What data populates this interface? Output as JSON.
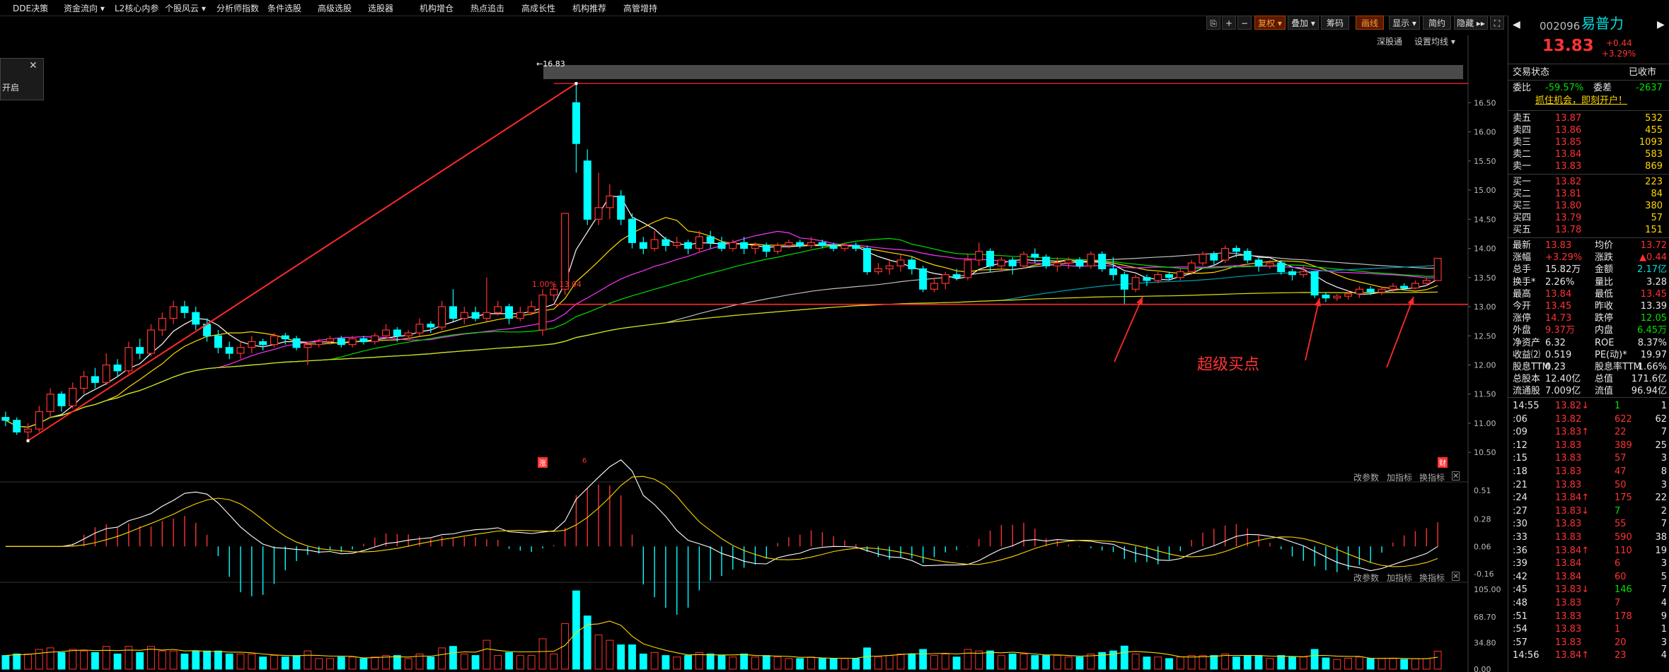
{
  "menu": [
    "DDE决策",
    "资金流向 ▾",
    "L2核心内参",
    "个股风云 ▾",
    "分析师指数",
    "条件选股",
    "高级选股",
    "选股器",
    "机构增仓",
    "热点追击",
    "高成长性",
    "机构推荐",
    "高管增持"
  ],
  "toolbar": {
    "icons": [
      "⎘",
      "+",
      "−"
    ],
    "buttons": [
      "复权 ▾",
      "叠加 ▾",
      "筹码",
      "画线",
      "显示 ▾",
      "简约",
      "隐藏 ▸▸"
    ],
    "active": [
      "复权 ▾",
      "画线"
    ],
    "fullscreen_icon": "⛶"
  },
  "chart_links": {
    "a": "深股通",
    "b": "设置均线 ▾"
  },
  "panel_tools": [
    "改参数",
    "加指标",
    "换指标"
  ],
  "left_popup_label": "开启",
  "annotations": {
    "high_label": "←16.83",
    "support_label": "1.00% 13.04",
    "buy_point": "超级买点",
    "badge_zhang": "涨",
    "badge_six": "6",
    "badge_cai": "财"
  },
  "colors": {
    "up": "#ff3232",
    "down": "#00ffff",
    "ma5": "#ffffff",
    "ma10": "#ffd700",
    "ma20": "#ff33ff",
    "ma30": "#00e000",
    "ma60": "#c0c0c0",
    "ma120": "#00a0b0",
    "ma250": "#e0e000"
  },
  "chart_data": {
    "type": "candlestick",
    "price_axis": [
      "16.50",
      "16.00",
      "15.50",
      "15.00",
      "14.50",
      "14.00",
      "13.50",
      "13.00",
      "12.50",
      "12.00",
      "11.50",
      "11.00",
      "10.50"
    ],
    "price_range": [
      10.26,
      16.88
    ],
    "hline": 13.04,
    "high": 16.83,
    "low": 10.7,
    "candles": [
      [
        11.1,
        11.05,
        11.2,
        10.95
      ],
      [
        11.05,
        10.85,
        11.1,
        10.8
      ],
      [
        10.85,
        10.9,
        11.0,
        10.7
      ],
      [
        10.9,
        11.2,
        11.3,
        10.85
      ],
      [
        11.2,
        11.5,
        11.6,
        11.1
      ],
      [
        11.5,
        11.3,
        11.55,
        11.2
      ],
      [
        11.3,
        11.6,
        11.7,
        11.25
      ],
      [
        11.6,
        11.8,
        11.9,
        11.5
      ],
      [
        11.8,
        11.7,
        11.95,
        11.6
      ],
      [
        11.7,
        12.0,
        12.2,
        11.65
      ],
      [
        12.0,
        11.9,
        12.1,
        11.8
      ],
      [
        11.9,
        12.3,
        12.4,
        11.85
      ],
      [
        12.3,
        12.2,
        12.45,
        12.1
      ],
      [
        12.2,
        12.6,
        12.7,
        12.15
      ],
      [
        12.6,
        12.8,
        12.9,
        12.5
      ],
      [
        12.8,
        13.0,
        13.1,
        12.7
      ],
      [
        13.0,
        12.9,
        13.1,
        12.8
      ],
      [
        12.9,
        12.7,
        13.0,
        12.6
      ],
      [
        12.7,
        12.5,
        12.8,
        12.4
      ],
      [
        12.5,
        12.3,
        12.6,
        12.2
      ],
      [
        12.3,
        12.2,
        12.4,
        12.1
      ],
      [
        12.2,
        12.3,
        12.4,
        12.1
      ],
      [
        12.3,
        12.4,
        12.5,
        12.2
      ],
      [
        12.4,
        12.35,
        12.45,
        12.25
      ],
      [
        12.35,
        12.5,
        12.55,
        12.3
      ],
      [
        12.5,
        12.45,
        12.55,
        12.35
      ],
      [
        12.45,
        12.3,
        12.5,
        12.25
      ],
      [
        12.3,
        12.35,
        12.4,
        12.0
      ],
      [
        12.35,
        12.4,
        12.45,
        12.3
      ],
      [
        12.4,
        12.45,
        12.5,
        12.35
      ],
      [
        12.45,
        12.35,
        12.5,
        12.3
      ],
      [
        12.35,
        12.45,
        12.5,
        12.3
      ],
      [
        12.45,
        12.4,
        12.5,
        12.35
      ],
      [
        12.4,
        12.5,
        12.55,
        12.35
      ],
      [
        12.5,
        12.6,
        12.7,
        12.45
      ],
      [
        12.6,
        12.5,
        12.65,
        12.4
      ],
      [
        12.5,
        12.55,
        12.6,
        12.45
      ],
      [
        12.55,
        12.7,
        12.8,
        12.5
      ],
      [
        12.7,
        12.65,
        12.75,
        12.55
      ],
      [
        12.65,
        13.0,
        13.1,
        12.6
      ],
      [
        13.0,
        12.8,
        13.3,
        12.75
      ],
      [
        12.8,
        12.9,
        13.0,
        12.7
      ],
      [
        12.9,
        12.8,
        13.0,
        12.75
      ],
      [
        12.8,
        12.9,
        13.5,
        12.75
      ],
      [
        12.9,
        13.0,
        13.1,
        12.85
      ],
      [
        13.0,
        12.8,
        13.05,
        12.7
      ],
      [
        12.8,
        12.9,
        13.0,
        12.75
      ],
      [
        12.9,
        13.0,
        13.1,
        12.85
      ],
      [
        12.6,
        13.2,
        13.3,
        12.5
      ],
      [
        13.2,
        13.3,
        13.4,
        13.1
      ],
      [
        13.3,
        14.6,
        14.6,
        13.2
      ],
      [
        16.5,
        15.8,
        16.83,
        15.3
      ],
      [
        15.5,
        14.5,
        15.7,
        14.4
      ],
      [
        14.5,
        14.7,
        15.3,
        14.4
      ],
      [
        14.7,
        14.9,
        15.1,
        14.5
      ],
      [
        14.9,
        14.5,
        15.0,
        14.4
      ],
      [
        14.5,
        14.1,
        14.6,
        14.0
      ],
      [
        14.1,
        14.0,
        14.2,
        13.9
      ],
      [
        14.0,
        14.15,
        14.3,
        13.95
      ],
      [
        14.15,
        14.05,
        14.2,
        13.95
      ],
      [
        14.05,
        14.1,
        14.2,
        14.0
      ],
      [
        14.1,
        14.0,
        14.15,
        13.9
      ],
      [
        14.0,
        14.2,
        14.3,
        13.95
      ],
      [
        14.2,
        14.1,
        14.3,
        14.0
      ],
      [
        14.1,
        14.0,
        14.2,
        13.95
      ],
      [
        14.0,
        14.1,
        14.15,
        13.95
      ],
      [
        14.1,
        14.0,
        14.2,
        13.9
      ],
      [
        14.0,
        14.05,
        14.1,
        13.9
      ],
      [
        14.05,
        13.95,
        14.1,
        13.85
      ],
      [
        13.95,
        14.05,
        14.1,
        13.9
      ],
      [
        14.05,
        14.1,
        14.15,
        14.0
      ],
      [
        14.1,
        14.05,
        14.15,
        14.0
      ],
      [
        14.05,
        14.1,
        14.2,
        14.0
      ],
      [
        14.1,
        14.05,
        14.15,
        14.0
      ],
      [
        14.05,
        14.0,
        14.1,
        13.95
      ],
      [
        14.0,
        14.05,
        14.1,
        13.95
      ],
      [
        14.05,
        14.0,
        14.1,
        13.95
      ],
      [
        14.0,
        13.6,
        14.05,
        13.55
      ],
      [
        13.6,
        13.65,
        13.75,
        13.55
      ],
      [
        13.65,
        13.7,
        13.8,
        13.55
      ],
      [
        13.7,
        13.8,
        13.9,
        13.6
      ],
      [
        13.8,
        13.65,
        13.85,
        13.55
      ],
      [
        13.65,
        13.3,
        13.7,
        13.25
      ],
      [
        13.3,
        13.4,
        13.5,
        13.25
      ],
      [
        13.4,
        13.55,
        13.6,
        13.3
      ],
      [
        13.55,
        13.5,
        13.65,
        13.45
      ],
      [
        13.5,
        13.8,
        13.9,
        13.45
      ],
      [
        13.8,
        13.95,
        14.1,
        13.7
      ],
      [
        13.95,
        13.7,
        14.0,
        13.6
      ],
      [
        13.7,
        13.8,
        13.85,
        13.6
      ],
      [
        13.8,
        13.7,
        13.85,
        13.55
      ],
      [
        13.7,
        13.9,
        13.95,
        13.65
      ],
      [
        13.9,
        13.85,
        14.0,
        13.75
      ],
      [
        13.85,
        13.7,
        13.9,
        13.65
      ],
      [
        13.7,
        13.75,
        13.85,
        13.6
      ],
      [
        13.75,
        13.8,
        13.85,
        13.65
      ],
      [
        13.8,
        13.7,
        13.85,
        13.65
      ],
      [
        13.7,
        13.9,
        13.95,
        13.65
      ],
      [
        13.9,
        13.65,
        13.95,
        13.6
      ],
      [
        13.65,
        13.55,
        13.85,
        13.45
      ],
      [
        13.55,
        13.3,
        13.6,
        13.04
      ],
      [
        13.3,
        13.5,
        13.55,
        13.25
      ],
      [
        13.5,
        13.45,
        13.55,
        13.35
      ],
      [
        13.45,
        13.55,
        13.6,
        13.4
      ],
      [
        13.55,
        13.5,
        13.6,
        13.45
      ],
      [
        13.5,
        13.6,
        13.65,
        13.45
      ],
      [
        13.6,
        13.75,
        13.8,
        13.55
      ],
      [
        13.75,
        13.9,
        13.95,
        13.7
      ],
      [
        13.9,
        13.8,
        13.95,
        13.7
      ],
      [
        13.8,
        14.0,
        14.05,
        13.75
      ],
      [
        14.0,
        13.95,
        14.05,
        13.85
      ],
      [
        13.95,
        13.8,
        14.0,
        13.75
      ],
      [
        13.8,
        13.7,
        13.85,
        13.6
      ],
      [
        13.7,
        13.75,
        13.8,
        13.65
      ],
      [
        13.75,
        13.6,
        13.8,
        13.55
      ],
      [
        13.6,
        13.55,
        13.65,
        13.45
      ],
      [
        13.55,
        13.6,
        13.7,
        13.5
      ],
      [
        13.6,
        13.2,
        13.6,
        13.15
      ],
      [
        13.2,
        13.15,
        13.25,
        13.08
      ],
      [
        13.15,
        13.18,
        13.22,
        13.1
      ],
      [
        13.18,
        13.22,
        13.28,
        13.12
      ],
      [
        13.22,
        13.3,
        13.35,
        13.15
      ],
      [
        13.3,
        13.25,
        13.35,
        13.2
      ],
      [
        13.25,
        13.3,
        13.35,
        13.2
      ],
      [
        13.3,
        13.35,
        13.4,
        13.25
      ],
      [
        13.35,
        13.32,
        13.4,
        13.28
      ],
      [
        13.32,
        13.4,
        13.45,
        13.3
      ],
      [
        13.4,
        13.45,
        13.5,
        13.35
      ],
      [
        13.45,
        13.83,
        13.84,
        13.45
      ]
    ],
    "macd_axis": [
      "0.51",
      "0.28",
      "0.06",
      "-0.16"
    ],
    "vol_axis": [
      "105.00",
      "68.70",
      "34.80",
      "0.00"
    ]
  },
  "quote": {
    "code": "002096",
    "name": "易普力",
    "price": "13.83",
    "change": "+0.44",
    "change_pct": "+3.29%",
    "status_label": "交易状态",
    "status_value": "已收市",
    "wb_label": "委比",
    "wb_value": "-59.57%",
    "wc_label": "委差",
    "wc_value": "-2637",
    "promo": "抓住机会，即刻开户！",
    "asks": [
      [
        "卖五",
        "13.87",
        "532"
      ],
      [
        "卖四",
        "13.86",
        "455"
      ],
      [
        "卖三",
        "13.85",
        "1093"
      ],
      [
        "卖二",
        "13.84",
        "583"
      ],
      [
        "卖一",
        "13.83",
        "869"
      ]
    ],
    "bids": [
      [
        "买一",
        "13.82",
        "223"
      ],
      [
        "买二",
        "13.81",
        "84"
      ],
      [
        "买三",
        "13.80",
        "380"
      ],
      [
        "买四",
        "13.79",
        "57"
      ],
      [
        "买五",
        "13.78",
        "151"
      ]
    ],
    "stats": [
      [
        "最新",
        "13.83",
        "均价",
        "13.72"
      ],
      [
        "涨幅",
        "+3.29%",
        "涨跌",
        "▲0.44"
      ],
      [
        "总手",
        "15.82万",
        "金额",
        "2.17亿"
      ],
      [
        "换手*",
        "2.26%",
        "量比",
        "3.28"
      ],
      [
        "最高",
        "13.84",
        "最低",
        "13.45"
      ],
      [
        "今开",
        "13.45",
        "昨收",
        "13.39"
      ],
      [
        "涨停",
        "14.73",
        "跌停",
        "12.05"
      ],
      [
        "外盘",
        "9.37万",
        "内盘",
        "6.45万"
      ],
      [
        "净资产",
        "6.32",
        "ROE",
        "8.37%"
      ],
      [
        "收益⑵",
        "0.519",
        "PE(动)*",
        "19.97"
      ],
      [
        "股息TTM",
        "0.23",
        "股息率TTM",
        "1.66%"
      ],
      [
        "总股本",
        "12.40亿",
        "总值",
        "171.6亿"
      ],
      [
        "流通股",
        "7.009亿",
        "流值",
        "96.94亿"
      ]
    ],
    "ticks": [
      [
        "14:55",
        "13.82",
        "↓",
        "1",
        "1"
      ],
      [
        ":06",
        "13.82",
        "",
        "622",
        "62"
      ],
      [
        ":09",
        "13.83",
        "↑",
        "22",
        "7"
      ],
      [
        ":12",
        "13.83",
        "",
        "389",
        "25"
      ],
      [
        ":15",
        "13.83",
        "",
        "57",
        "3"
      ],
      [
        ":18",
        "13.83",
        "",
        "47",
        "8"
      ],
      [
        ":21",
        "13.83",
        "",
        "50",
        "3"
      ],
      [
        ":24",
        "13.84",
        "↑",
        "175",
        "22"
      ],
      [
        ":27",
        "13.83",
        "↓",
        "7",
        "2"
      ],
      [
        ":30",
        "13.83",
        "",
        "55",
        "7"
      ],
      [
        ":33",
        "13.83",
        "",
        "590",
        "38"
      ],
      [
        ":36",
        "13.84",
        "↑",
        "110",
        "19"
      ],
      [
        ":39",
        "13.84",
        "",
        "6",
        "3"
      ],
      [
        ":42",
        "13.84",
        "",
        "60",
        "5"
      ],
      [
        ":45",
        "13.83",
        "↓",
        "146",
        "7"
      ],
      [
        ":48",
        "13.83",
        "",
        "7",
        "4"
      ],
      [
        ":51",
        "13.83",
        "",
        "178",
        "9"
      ],
      [
        ":54",
        "13.83",
        "",
        "1",
        "1"
      ],
      [
        ":57",
        "13.83",
        "",
        "20",
        "3"
      ],
      [
        "14:56",
        "13.84",
        "↑",
        "23",
        "4"
      ]
    ]
  }
}
